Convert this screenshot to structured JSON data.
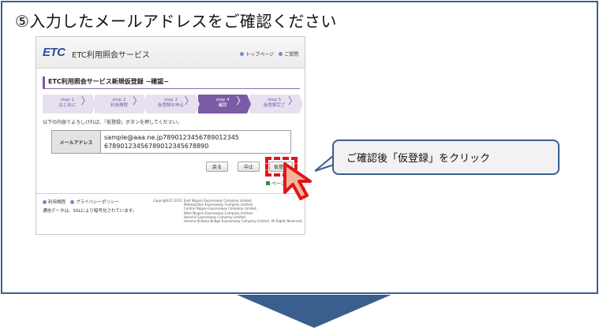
{
  "heading": "⑤入力したメールアドレスをご確認ください",
  "site": {
    "logo": "ETC",
    "service_name": "ETC利用照会サービス",
    "header_links": [
      "トップページ",
      "ご質問"
    ],
    "panel_title": "ETC利用照会サービス新規仮登録 −確認−",
    "steps": [
      {
        "line1": "step 1",
        "line2": "はじめに"
      },
      {
        "line1": "step 2",
        "line2": "利用規程"
      },
      {
        "line1": "step 3",
        "line2": "仮登録お申込"
      },
      {
        "line1": "step 4",
        "line2": "確認"
      },
      {
        "line1": "step 5",
        "line2": "仮登録完了"
      }
    ],
    "active_step": 3,
    "instruction": "以下の内容でよろしければ、「仮登録」ボタンを押してください。",
    "table": {
      "label": "メールアドレス",
      "value_line1": "sample@aaa.ne.jp7890123456789012345",
      "value_line2": "67890123456789012345678890"
    },
    "buttons": {
      "back": "戻る",
      "stop": "中止",
      "register": "仮登録"
    },
    "page_top": "ページの",
    "footer_links": [
      "利用規程",
      "プライバシーポリシー"
    ],
    "ssl_note": "通信データは、SSLにより暗号化されています。",
    "copyright": "Copyright(C) 2011",
    "companies": [
      "East Nippon Expressway Company Limited,",
      "Metropolitan Expressway Company Limited,",
      "Central Nippon Expressway Company Limited,",
      "West Nippon Expressway Company Limited,",
      "Hanshin Expressway Company Limited,",
      "Honshu-Shikoku Bridge Expressway Company Limited. All Rights Reserved."
    ]
  },
  "callout": "ご確認後「仮登録」をクリック",
  "colors": {
    "frame_border": "#3a5f8f",
    "step_active": "#7b5aa6",
    "step_inactive": "#e7e1ef",
    "highlight": "#e0161b",
    "arrow": "#3a5f8f"
  }
}
